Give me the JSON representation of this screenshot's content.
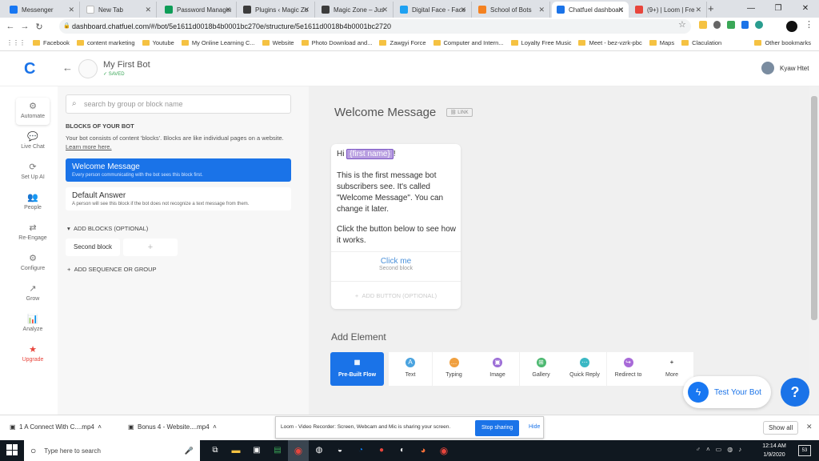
{
  "browser": {
    "tabs": [
      {
        "title": "Messenger",
        "color": "#1877f2"
      },
      {
        "title": "New Tab",
        "color": "#ffffff"
      },
      {
        "title": "Password Manager",
        "color": "#0f9d58"
      },
      {
        "title": "Plugins ‹ Magic Zo",
        "color": "#3c3c3c"
      },
      {
        "title": "Magic Zone – Jus",
        "color": "#3c3c3c"
      },
      {
        "title": "Digital Face - Face",
        "color": "#1da1f2"
      },
      {
        "title": "School of Bots",
        "color": "#f48120"
      },
      {
        "title": "Chatfuel dashboard",
        "color": "#1a73e8"
      },
      {
        "title": "(9+) | Loom | Fre",
        "color": "#e8453c"
      }
    ],
    "url": "dashboard.chatfuel.com/#/bot/5e1611d0018b4b0001bc270e/structure/5e1611d0018b4b0001bc2720",
    "bookmarks": [
      "Facebook",
      "content marketing",
      "Youtube",
      "My Online Learning C...",
      "Website",
      "Photo Download and...",
      "Zawgyi Force",
      "Computer and Intern...",
      "Loyalty Free Music",
      "Meet - bez-vzrk-pbc",
      "Maps",
      "Claculation"
    ],
    "other_bookmarks": "Other bookmarks"
  },
  "app": {
    "bot_name": "My First Bot",
    "saved_label": "SAVED",
    "user_name": "Kyaw Htet",
    "rail": [
      "Automate",
      "Live Chat",
      "Set Up AI",
      "People",
      "Re-Engage",
      "Configure",
      "Grow",
      "Analyze",
      "Upgrade"
    ],
    "search_placeholder": "search by group or block name",
    "blocks_heading": "BLOCKS OF YOUR BOT",
    "blocks_desc": "Your bot consists of content 'blocks'. Blocks are like individual pages on a website.",
    "learn_more": "Learn more here.",
    "welcome_title": "Welcome Message",
    "welcome_desc": "Every person communicating with the bot sees this block first.",
    "default_title": "Default Answer",
    "default_desc": "A person will see this block if the bot does not recognize a text message from them.",
    "add_blocks": "ADD BLOCKS (OPTIONAL)",
    "second_block": "Second block",
    "add_sequence": "ADD SEQUENCE OR GROUP",
    "editor_title": "Welcome Message",
    "link_label": "LINK",
    "msg_hi": "Hi",
    "msg_name": "{first name}",
    "msg_excl": "!",
    "msg_p1": "This is the first message bot subscribers see. It's called \"Welcome Message\". You can change it later.",
    "msg_p2": "Click the button below to see how it works.",
    "button_label": "Click me",
    "button_target": "Second block",
    "add_button": "ADD BUTTON (OPTIONAL)",
    "add_element": "Add Element",
    "elements": [
      {
        "label": "Pre-Built Flow",
        "color": "#1a73e8"
      },
      {
        "label": "Text",
        "color": "#4aa3df"
      },
      {
        "label": "Typing",
        "color": "#f0a040"
      },
      {
        "label": "Image",
        "color": "#9b6cd6"
      },
      {
        "label": "Gallery",
        "color": "#4cb870"
      },
      {
        "label": "Quick Reply",
        "color": "#3bb8c4"
      },
      {
        "label": "Redirect to",
        "color": "#a86ad8"
      },
      {
        "label": "More",
        "color": "#000000"
      }
    ],
    "test_bot": "Test Your Bot",
    "help_q": "?"
  },
  "downloads": {
    "items": [
      "1 A Connect With C....mp4",
      "Bonus 4 - Website....mp4"
    ],
    "loom_text": "Loom - Video Recorder: Screen, Webcam and Mic is sharing your screen.",
    "stop_sharing": "Stop sharing",
    "hide": "Hide",
    "show_all": "Show all"
  },
  "taskbar": {
    "search_placeholder": "Type here to search",
    "time": "12:14 AM",
    "date": "1/9/2020",
    "notif_count": "53"
  }
}
